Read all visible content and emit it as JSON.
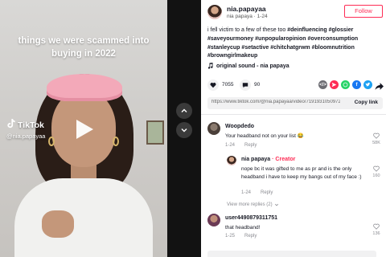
{
  "video": {
    "overlay_caption": "things we were scammed into buying in 2022",
    "watermark_brand": "TikTok",
    "watermark_handle": "@nia.papayaa"
  },
  "author": {
    "username": "nia.papayaa",
    "display_name": "nia papaya",
    "date": "1-24",
    "follow_label": "Follow"
  },
  "description": {
    "intro": "i fell victim to a few of these too ",
    "hashtags": [
      "#deinfluencing",
      "#glossier",
      "#saveyourmoney",
      "#unpopularopinion",
      "#overconsumption",
      "#stanleycup",
      "#setactive",
      "#chitchatgrwm",
      "#bloomnutrition",
      "#browngirlmakeup"
    ]
  },
  "sound": {
    "label": "original sound - nia papaya"
  },
  "stats": {
    "likes": "7055",
    "comments": "90"
  },
  "link": {
    "url": "https://www.tiktok.com/@nia.papayaa/video/7191931050972...",
    "copy_label": "Copy link"
  },
  "share_icons": [
    "embed-icon",
    "tiktok-friends-icon",
    "whatsapp-icon",
    "facebook-icon",
    "twitter-icon",
    "share-arrow-icon"
  ],
  "colors": {
    "accent": "#fe2c55",
    "embed": "#6d6d73",
    "friends": "#fe2c55",
    "whatsapp": "#25d366",
    "facebook": "#1877f2",
    "twitter": "#1da1f2"
  },
  "comments": [
    {
      "name": "Woopdedo",
      "text": "Your headband not on your list 😂",
      "date": "1-24",
      "reply_label": "Reply",
      "likes": "58K"
    },
    {
      "name": "nia papaya",
      "creator_label": "Creator",
      "text": "nope bc it was gifted to me as pr and is the only headband i have to keep my bangs out of my face :)",
      "date": "1-24",
      "reply_label": "Reply",
      "likes": "160"
    },
    {
      "name": "user4490879311751",
      "text": "that headband!",
      "date": "1-25",
      "reply_label": "Reply",
      "likes": "136"
    }
  ],
  "more_replies_label": "View more replies (2)"
}
